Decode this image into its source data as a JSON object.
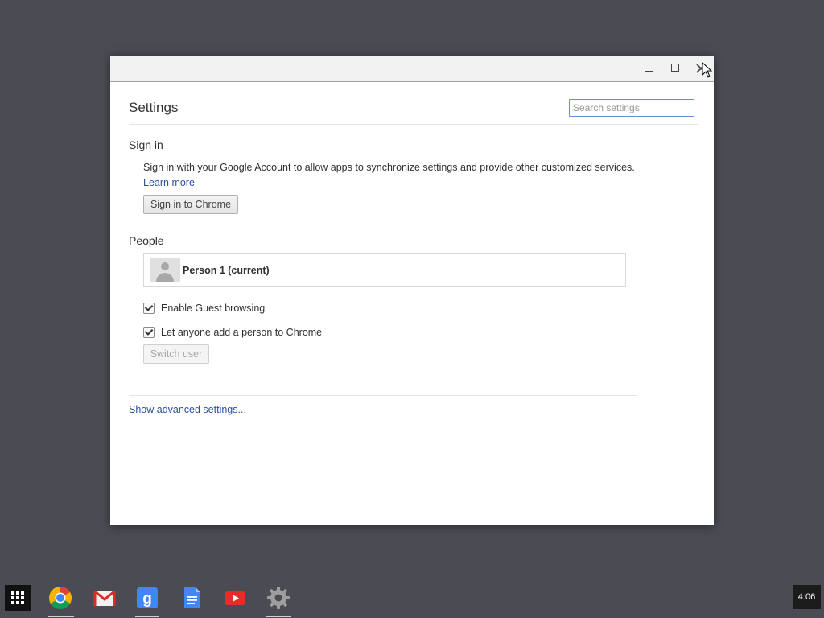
{
  "window": {
    "controls": [
      "minimize-icon",
      "maximize-icon",
      "close-icon"
    ]
  },
  "settings": {
    "title": "Settings",
    "search": {
      "placeholder": "Search settings",
      "value": ""
    },
    "sign_in": {
      "heading": "Sign in",
      "description": "Sign in with your Google Account to allow apps to synchronize settings and provide other customized services.",
      "learn_more": "Learn more",
      "button": "Sign in to Chrome"
    },
    "people": {
      "heading": "People",
      "profiles": [
        {
          "name": "Person 1 (current)"
        }
      ],
      "options": [
        {
          "label": "Enable Guest browsing",
          "checked": true
        },
        {
          "label": "Let anyone add a person to Chrome",
          "checked": true
        }
      ],
      "switch_user": "Switch user"
    },
    "advanced_link": "Show advanced settings..."
  },
  "shelf": {
    "apps": [
      "app-launcher-icon",
      "chrome-icon",
      "gmail-icon",
      "google-search-icon",
      "docs-icon",
      "youtube-icon",
      "settings-gear-icon"
    ],
    "clock": "4:06"
  }
}
